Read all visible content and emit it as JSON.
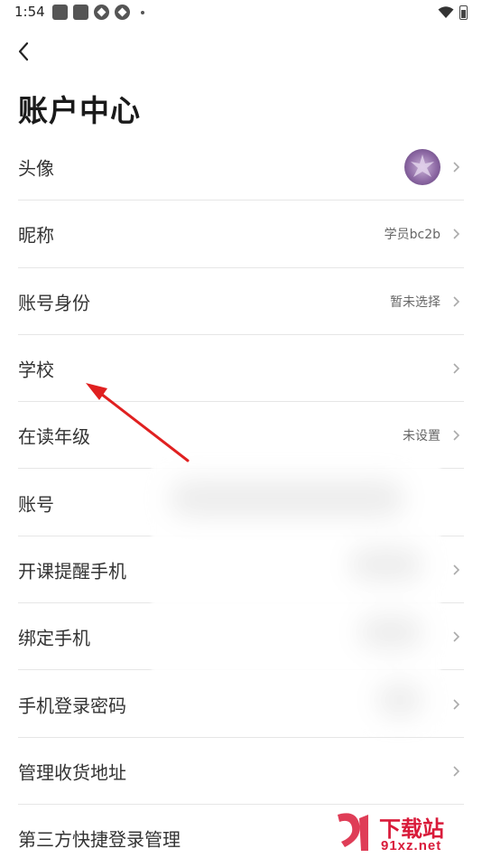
{
  "status_bar": {
    "time": "1:54"
  },
  "header": {
    "title": "账户中心"
  },
  "rows": [
    {
      "label": "头像",
      "value": "",
      "has_avatar": true
    },
    {
      "label": "昵称",
      "value": "学员bc2b"
    },
    {
      "label": "账号身份",
      "value": "暂未选择"
    },
    {
      "label": "学校",
      "value": ""
    },
    {
      "label": "在读年级",
      "value": "未设置"
    },
    {
      "label": "账号",
      "value": ""
    },
    {
      "label": "开课提醒手机",
      "value": ""
    },
    {
      "label": "绑定手机",
      "value": ""
    },
    {
      "label": "手机登录密码",
      "value": ""
    },
    {
      "label": "管理收货地址",
      "value": ""
    },
    {
      "label": "第三方快捷登录管理",
      "value": ""
    }
  ],
  "annotation": {
    "arrow_color": "#e02020"
  },
  "watermark": {
    "brand": "下载站",
    "domain": "91xz.net"
  }
}
